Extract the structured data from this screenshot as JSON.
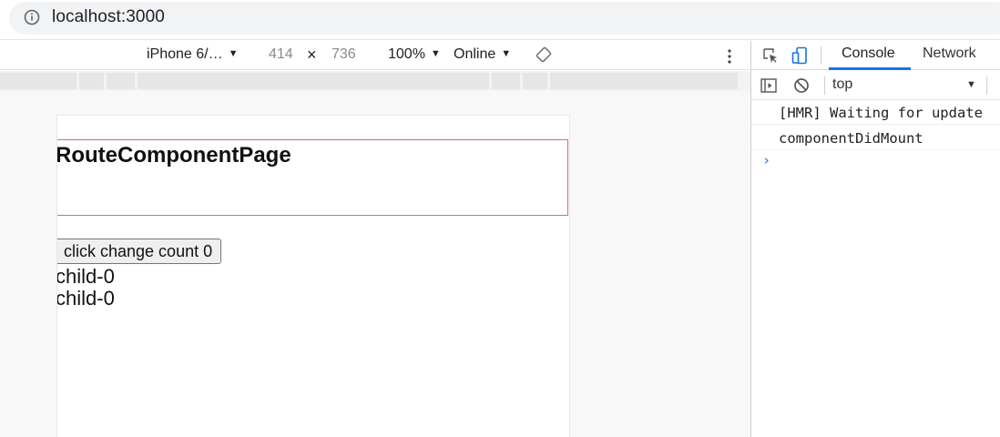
{
  "browser": {
    "url": "localhost:3000"
  },
  "device_toolbar": {
    "device": "iPhone 6/…",
    "width": "414",
    "times": "×",
    "height": "736",
    "zoom": "100%",
    "network": "Online",
    "caret": "▼"
  },
  "page": {
    "title": "RouteComponentPage",
    "button_label": "click change count 0",
    "child_lines": [
      "child-0",
      "child-0"
    ]
  },
  "devtools": {
    "tabs": [
      "Console",
      "Network"
    ],
    "active_tab": "Console",
    "context": "top",
    "context_caret": "▼",
    "console_messages": [
      "[HMR] Waiting for update",
      "componentDidMount"
    ],
    "prompt_symbol": "›"
  },
  "colors": {
    "accent": "#1a73e8",
    "route_border": "#d46a7e"
  }
}
